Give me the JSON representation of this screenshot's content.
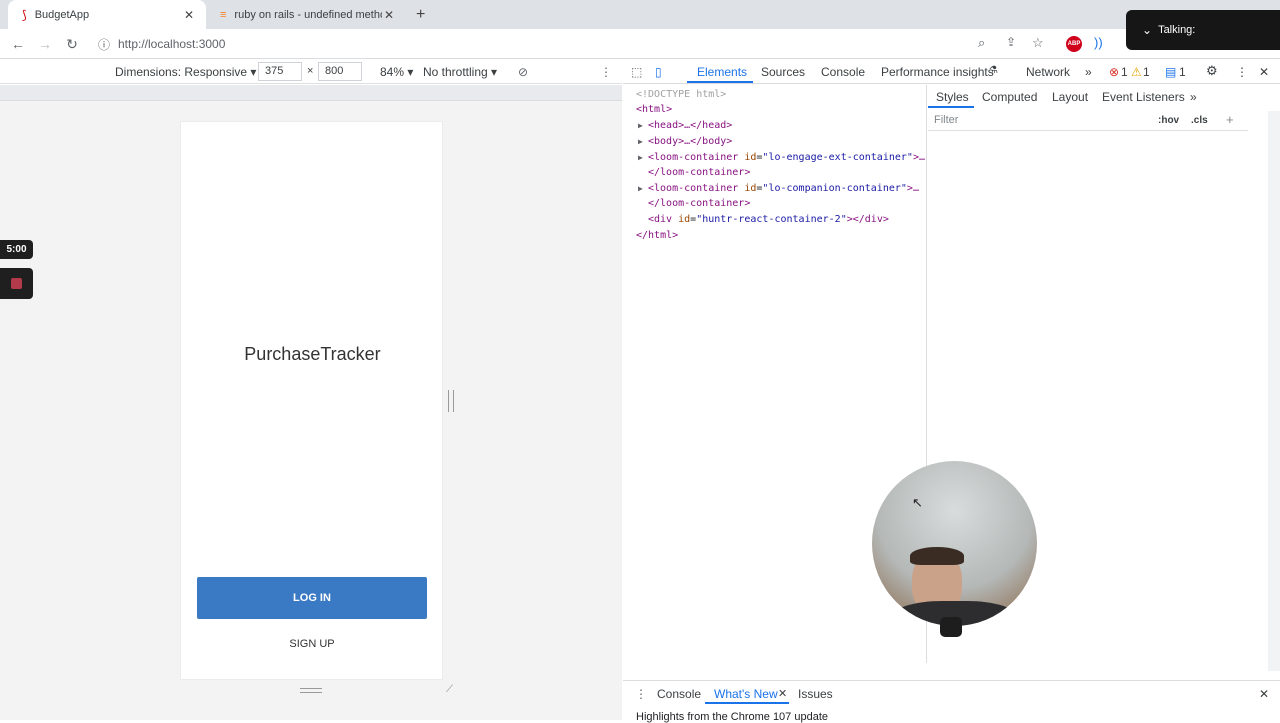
{
  "browser": {
    "tabs": [
      {
        "title": "BudgetApp",
        "active": true
      },
      {
        "title": "ruby on rails - undefined metho",
        "active": false
      }
    ],
    "url": "http://localhost:3000"
  },
  "device_toolbar": {
    "dimensions_label": "Dimensions: Responsive",
    "width": "375",
    "times": "×",
    "height": "800",
    "zoom": "84%",
    "throttling": "No throttling"
  },
  "app": {
    "brand": "PurchaseTracker",
    "login_label": "LOG IN",
    "signup_label": "SIGN UP"
  },
  "loom": {
    "timer": "5:00",
    "talking_label": "Talking:"
  },
  "devtools": {
    "tabs": [
      "Elements",
      "Sources",
      "Console",
      "Performance insights",
      "Network"
    ],
    "errors": "1",
    "warnings": "1",
    "messages": "1",
    "dom": {
      "doctype": "<!DOCTYPE html>",
      "html_open": "<html>",
      "head": "<head>…</head>",
      "body": "<body>…</body>",
      "loom1_open": "<loom-container",
      "loom1_attr": "id",
      "loom1_val": "\"lo-engage-ext-container\"",
      "loom1_rest": ">…",
      "loom1_close": "</loom-container>",
      "loom2_open": "<loom-container",
      "loom2_attr": "id",
      "loom2_val": "\"lo-companion-container\"",
      "loom2_rest": ">…",
      "loom2_close": "</loom-container>",
      "div_open": "<div",
      "div_attr": "id",
      "div_val": "\"huntr-react-container-2\"",
      "div_rest": "></div>",
      "html_close": "</html>"
    },
    "styles_tabs": [
      "Styles",
      "Computed",
      "Layout",
      "Event Listeners"
    ],
    "filter_placeholder": "Filter",
    "hov": ":hov",
    "cls": ".cls",
    "drawer_tabs": [
      "Console",
      "What's New",
      "Issues"
    ],
    "drawer_text": "Highlights from the Chrome 107 update"
  }
}
